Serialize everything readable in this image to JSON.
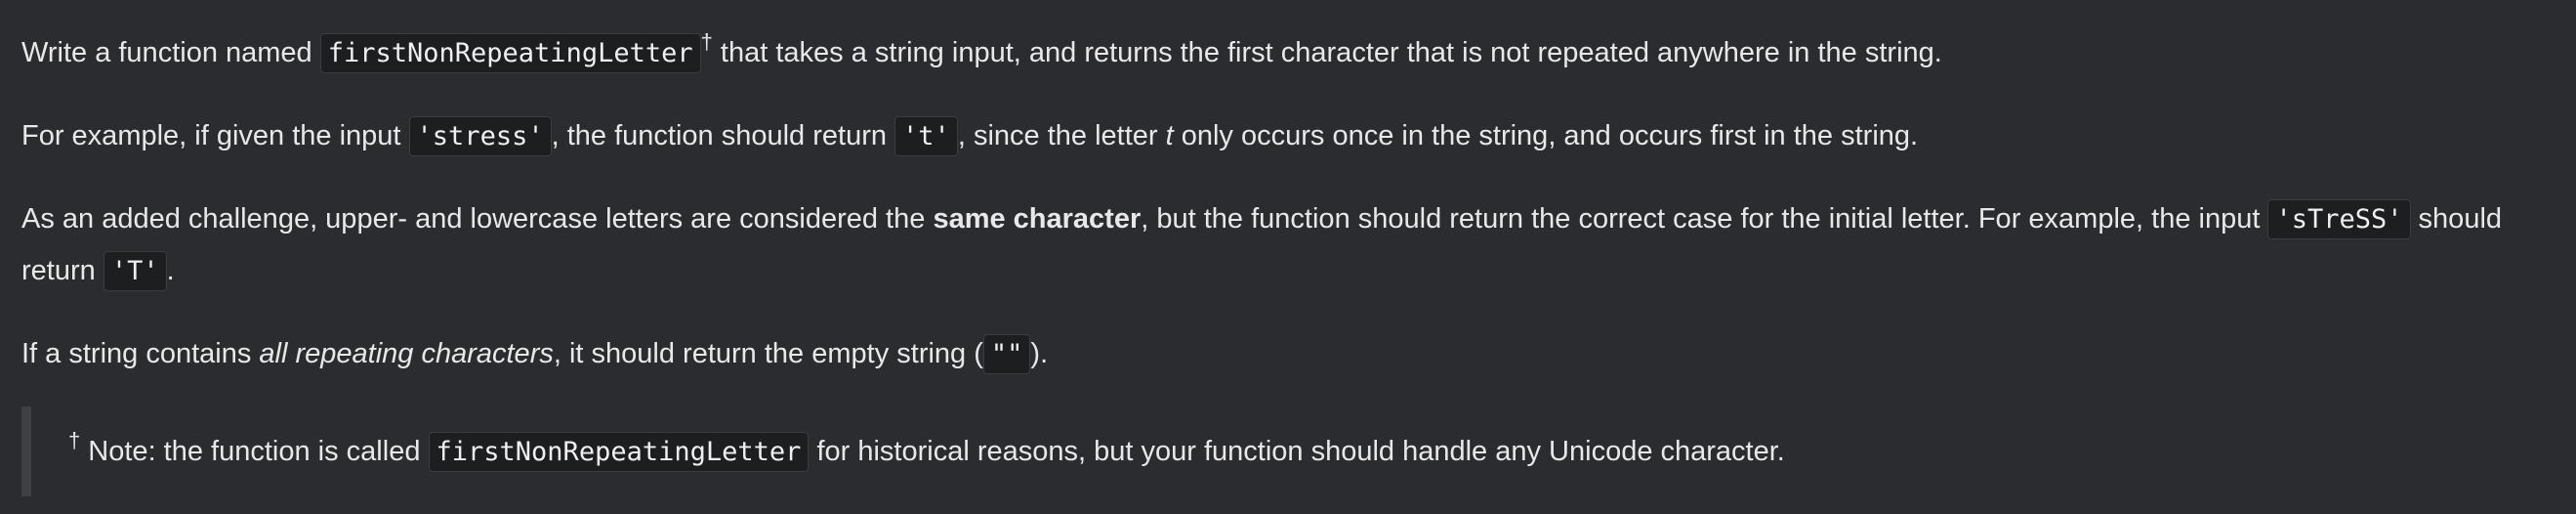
{
  "p1": {
    "t1": "Write a function named ",
    "code1": "firstNonRepeatingLetter",
    "dagger": "†",
    "t2": " that takes a string input, and returns the first character that is not repeated anywhere in the string."
  },
  "p2": {
    "t1": "For example, if given the input ",
    "code1": "'stress'",
    "t2": ", the function should return ",
    "code2": "'t'",
    "t3": ", since the letter ",
    "em1": "t",
    "t4": " only occurs once in the string, and occurs first in the string."
  },
  "p3": {
    "t1": "As an added challenge, upper- and lowercase letters are considered the ",
    "strong1": "same character",
    "t2": ", but the function should return the correct case for the initial letter. For example, the input ",
    "code1": "'sTreSS'",
    "t3": " should return ",
    "code2": "'T'",
    "t4": "."
  },
  "p4": {
    "t1": "If a string contains ",
    "em1": "all repeating characters",
    "t2": ", it should return the empty string (",
    "code1": "\"\"",
    "t3": ")."
  },
  "note": {
    "dagger": "†",
    "t1": " Note: the function is called ",
    "code1": "firstNonRepeatingLetter",
    "t2": " for historical reasons, but your function should handle any Unicode character."
  }
}
